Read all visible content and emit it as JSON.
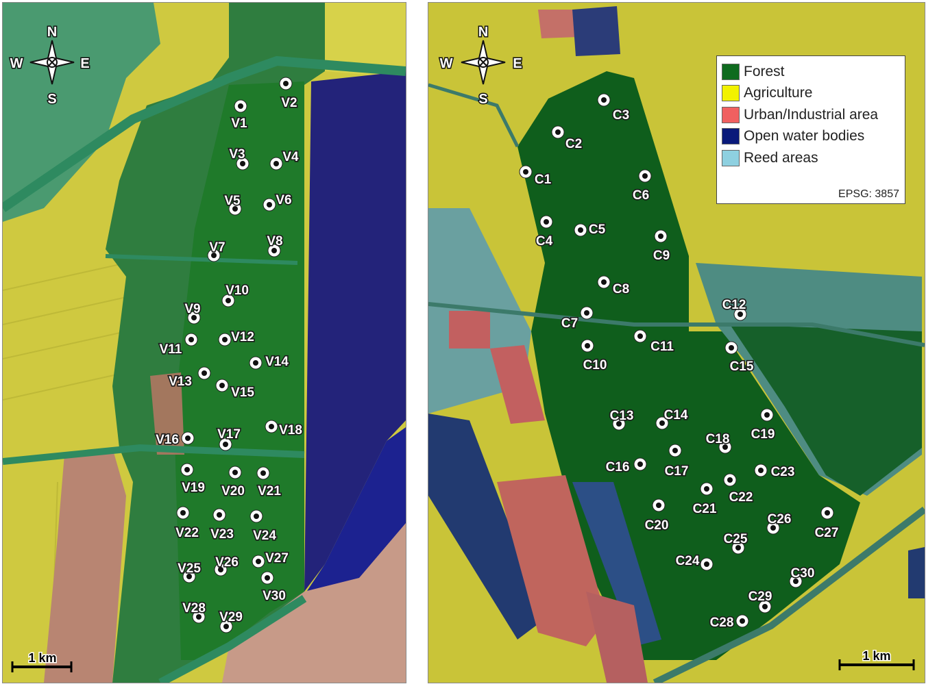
{
  "colors": {
    "forest": "#0f6b1f",
    "agriculture": "#f2f200",
    "urban": "#f06060",
    "water": "#0a1a7a",
    "reed": "#8ed0e0"
  },
  "compass": {
    "n": "N",
    "s": "S",
    "e": "E",
    "w": "W"
  },
  "scale_bar": {
    "left_label": "1 km",
    "right_label": "1 km"
  },
  "legend": {
    "items": [
      {
        "label": "Forest",
        "color": "#0f6b1f"
      },
      {
        "label": "Agriculture",
        "color": "#f2f200"
      },
      {
        "label": "Urban/Industrial area",
        "color": "#f06060"
      },
      {
        "label": "Open water bodies",
        "color": "#0a1a7a"
      },
      {
        "label": "Reed areas",
        "color": "#8ed0e0"
      }
    ],
    "crs": "EPSG: 3857"
  },
  "left_sites": [
    "V1",
    "V2",
    "V3",
    "V4",
    "V5",
    "V6",
    "V7",
    "V8",
    "V9",
    "V10",
    "V11",
    "V12",
    "V13",
    "V14",
    "V15",
    "V16",
    "V17",
    "V18",
    "V19",
    "V20",
    "V21",
    "V22",
    "V23",
    "V24",
    "V25",
    "V26",
    "V27",
    "V28",
    "V29",
    "V30"
  ],
  "right_sites": [
    "C1",
    "C2",
    "C3",
    "C4",
    "C5",
    "C6",
    "C7",
    "C8",
    "C9",
    "C10",
    "C11",
    "C12",
    "C13",
    "C14",
    "C15",
    "C16",
    "C17",
    "C18",
    "C19",
    "C20",
    "C21",
    "C22",
    "C23",
    "C24",
    "C25",
    "C26",
    "C27",
    "C28",
    "C29",
    "C30"
  ]
}
